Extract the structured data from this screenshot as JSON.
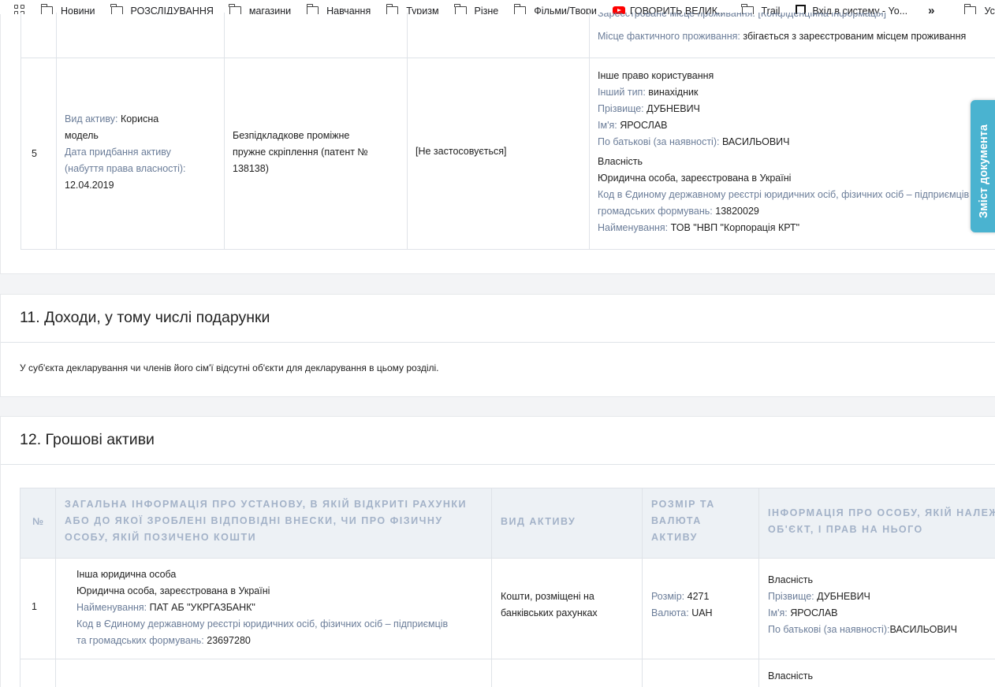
{
  "bookmarks": {
    "items": [
      "Новини",
      "РОЗСЛІДУВАННЯ",
      "магазини",
      "Навчання",
      "Туризм",
      "Різне",
      "Фільми/Твори",
      "ГОВОРИТЬ ВЕЛИК...",
      "Trail",
      "Вхід в систему - Yo..."
    ],
    "all_label": "Усі закладки"
  },
  "top_row": {
    "cut_text": "Зареєстроване місце проживання: [Конфіденційна інформація]",
    "label": "Місце фактичного проживання:",
    "value": "збігається з зареєстрованим місцем проживання"
  },
  "row5": {
    "num": "5",
    "asset_type_label": "Вид активу:",
    "asset_type_value": "Корисна",
    "asset_type_value2": "модель",
    "date_label": "Дата придбання активу",
    "date_label2": "(набуття права власності):",
    "date_value": "12.04.2019",
    "description": [
      "Безпідкладкове проміжне",
      "пружне скріплення (патент №",
      "138138)"
    ],
    "note": "[Не застосовується]",
    "right": {
      "right1_title": "Інше право користування",
      "other_type_label": "Інший тип:",
      "other_type_value": "винахідник",
      "surname_label": "Прізвище:",
      "surname_value": "ДУБНЕВИЧ",
      "name_label": "Ім'я:",
      "name_value": "ЯРОСЛАВ",
      "patronymic_label": "По батькові (за наявності):",
      "patronymic_value": "ВАСИЛЬОВИЧ",
      "right2_title": "Власність",
      "entity_type": "Юридична особа, зареєстрована в Україні",
      "code_label": "Код в Єдиному державному реєстрі юридичних осіб, фізичних осіб – підприємців та",
      "code_label2": "громадських формувань:",
      "code_value": "13820029",
      "org_label": "Найменування:",
      "org_value": "ТОВ \"НВП \"Корпорація КРТ\""
    }
  },
  "section11": {
    "title": "11. Доходи, у тому числі подарунки",
    "text": "У суб'єкта декларування чи членів його сім'ї відсутні об'єкти для декларування в цьому розділі."
  },
  "section12": {
    "title": "12. Грошові активи",
    "headers": {
      "num": "№",
      "institution": [
        "ЗАГАЛЬНА ІНФОРМАЦІЯ ПРО УСТАНОВУ, В ЯКІЙ ВІДКРИТІ РАХУНКИ",
        "АБО ДО ЯКОЇ ЗРОБЛЕНІ ВІДПОВІДНІ ВНЕСКИ, ЧИ ПРО ФІЗИЧНУ",
        "ОСОБУ, ЯКІЙ ПОЗИЧЕНО КОШТИ"
      ],
      "asset_type": "ВИД АКТИВУ",
      "amount": [
        "РОЗМІР ТА",
        "ВАЛЮТА",
        "АКТИВУ"
      ],
      "owner": [
        "ІНФОРМАЦІЯ ПРО ОСОБУ, ЯКІЙ НАЛЕЖИТЬ",
        "ОБ'ЄКТ, І ПРАВ НА НЬОГО"
      ]
    },
    "row1": {
      "num": "1",
      "inst_type": "Інша юридична особа",
      "inst_reg": "Юридична особа, зареєстрована в Україні",
      "inst_name_label": "Найменування:",
      "inst_name_value": "ПАТ АБ \"УКРГАЗБАНК\"",
      "inst_code_label": "Код в Єдиному державному реєстрі юридичних осіб, фізичних осіб – підприємців",
      "inst_code_label2": "та громадських формувань:",
      "inst_code_value": "23697280",
      "asset": [
        "Кошти, розміщені на",
        "банківських рахунках"
      ],
      "amount_label": "Розмір:",
      "amount_value": "4271",
      "currency_label": "Валюта:",
      "currency_value": "UAH",
      "ownership": "Власність",
      "surname_label": "Прізвище:",
      "surname_value": "ДУБНЕВИЧ",
      "name_label": "Ім'я:",
      "name_value": "ЯРОСЛАВ",
      "patronymic_label": "По батькові (за наявності):",
      "patronymic_value": "ВАСИЛЬОВИЧ"
    },
    "row2": {
      "ownership": "Власність"
    }
  },
  "side_tab": {
    "label": "Зміст документа"
  }
}
